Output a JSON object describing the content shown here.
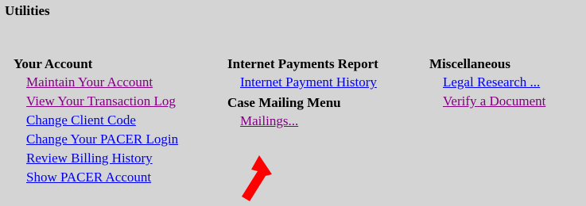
{
  "title": "Utilities",
  "sections": {
    "account": {
      "heading": "Your Account",
      "links": [
        {
          "label": "Maintain Your Account",
          "visited": true
        },
        {
          "label": "View Your Transaction Log",
          "visited": true
        },
        {
          "label": "Change Client Code",
          "visited": false
        },
        {
          "label": "Change Your PACER Login",
          "visited": false
        },
        {
          "label": "Review Billing History",
          "visited": false
        },
        {
          "label": "Show PACER Account",
          "visited": false
        }
      ]
    },
    "payments": {
      "heading": "Internet Payments Report",
      "links": [
        {
          "label": "Internet Payment History",
          "visited": false
        }
      ]
    },
    "mailing": {
      "heading": "Case Mailing Menu",
      "links": [
        {
          "label": "Mailings...",
          "visited": true
        }
      ]
    },
    "misc": {
      "heading": "Miscellaneous",
      "links": [
        {
          "label": "Legal Research ...",
          "visited": false
        },
        {
          "label": "Verify a Document",
          "visited": true
        }
      ]
    }
  },
  "colors": {
    "background": "#d4d4d4",
    "link_unvisited": "#0000ee",
    "link_visited": "#800080",
    "annotation_arrow": "#ff0000"
  },
  "annotation": {
    "icon": "red-arrow-icon"
  }
}
